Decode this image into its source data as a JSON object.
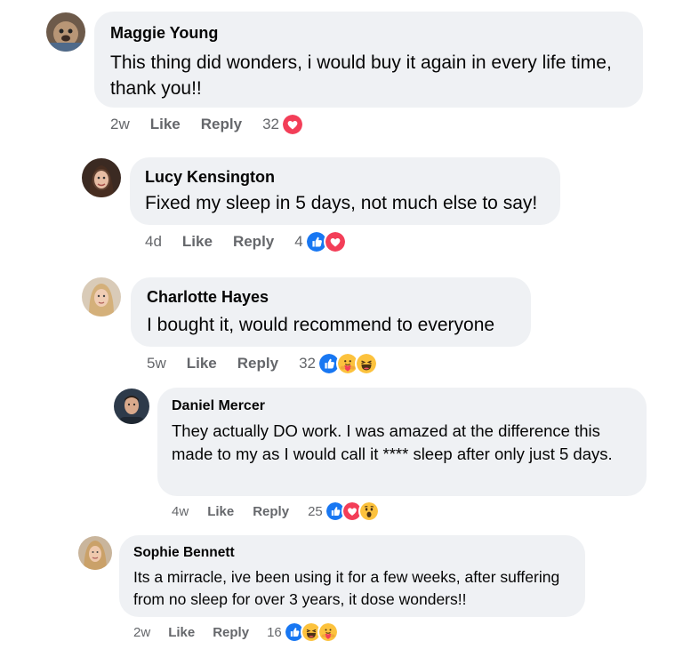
{
  "comments": [
    {
      "author": "Maggie Young",
      "text": "This thing did wonders, i would buy it again in every life time, thank you!!",
      "time": "2w",
      "like_label": "Like",
      "reply_label": "Reply",
      "reaction_count": "32",
      "reactions": [
        "love"
      ]
    },
    {
      "author": "Lucy Kensington",
      "text": "Fixed my sleep in 5 days, not much else to say!",
      "time": "4d",
      "like_label": "Like",
      "reply_label": "Reply",
      "reaction_count": "4",
      "reactions": [
        "like",
        "love"
      ]
    },
    {
      "author": "Charlotte Hayes",
      "text": "I bought it, would recommend to everyone",
      "time": "5w",
      "like_label": "Like",
      "reply_label": "Reply",
      "reaction_count": "32",
      "reactions": [
        "like",
        "care",
        "haha"
      ]
    },
    {
      "author": "Daniel Mercer",
      "text": "They actually DO work.  I was amazed at the difference this made to my as I would call it **** sleep after only just 5 days.",
      "time": "4w",
      "like_label": "Like",
      "reply_label": "Reply",
      "reaction_count": "25",
      "reactions": [
        "like",
        "love",
        "wow"
      ]
    },
    {
      "author": "Sophie Bennett",
      "text": "Its a mirracle, ive been using it for a few weeks, after suffering from no sleep for over 3 years, it dose wonders!!",
      "time": "2w",
      "like_label": "Like",
      "reply_label": "Reply",
      "reaction_count": "16",
      "reactions": [
        "like",
        "haha",
        "care"
      ]
    }
  ],
  "colors": {
    "bubble": "#eff1f4",
    "meta_text": "#65676b",
    "like_blue": "#1877f2",
    "love_red": "#f33e58",
    "emoji_yellow": "#fcc23d"
  }
}
